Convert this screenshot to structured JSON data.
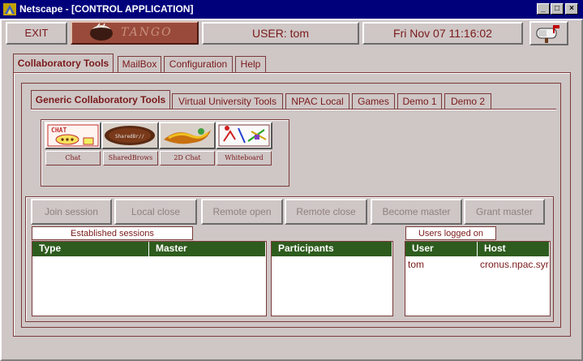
{
  "window": {
    "title": "Netscape - [CONTROL APPLICATION]",
    "minimize_glyph": "_",
    "maximize_glyph": "□",
    "close_glyph": "×"
  },
  "topbar": {
    "exit_label": "EXIT",
    "logo_text": "TANGO",
    "user_label": "USER: tom",
    "datetime": "Fri Nov 07 11:16:02",
    "mail_icon": "mailbox-icon"
  },
  "main_tabs": [
    {
      "label": "Collaboratory Tools",
      "active": true
    },
    {
      "label": "MailBox",
      "active": false
    },
    {
      "label": "Configuration",
      "active": false
    },
    {
      "label": "Help",
      "active": false
    }
  ],
  "sub_tabs": [
    {
      "label": "Generic Collaboratory Tools",
      "active": true
    },
    {
      "label": "Virtual University Tools",
      "active": false
    },
    {
      "label": "NPAC Local",
      "active": false
    },
    {
      "label": "Games",
      "active": false
    },
    {
      "label": "Demo 1",
      "active": false
    },
    {
      "label": "Demo 2",
      "active": false
    }
  ],
  "tools": [
    {
      "label": "Chat",
      "icon": "chat-icon",
      "icon_text": "CHAT"
    },
    {
      "label": "SharedBrows",
      "icon": "shared-browser-icon",
      "icon_text": "SharedBr//"
    },
    {
      "label": "2D Chat",
      "icon": "2d-chat-icon",
      "icon_text": ""
    },
    {
      "label": "Whiteboard",
      "icon": "whiteboard-icon",
      "icon_text": ""
    }
  ],
  "session_buttons": [
    {
      "label": "Join session"
    },
    {
      "label": "Local close"
    },
    {
      "label": "Remote open"
    },
    {
      "label": "Remote close"
    },
    {
      "label": "Become master"
    },
    {
      "label": "Grant master"
    }
  ],
  "sessions": {
    "title": "Established sessions",
    "columns": [
      "Type",
      "Master"
    ],
    "rows": []
  },
  "participants": {
    "columns": [
      "Participants"
    ],
    "rows": []
  },
  "users": {
    "title": "Users logged on",
    "columns": [
      "User",
      "Host"
    ],
    "rows": [
      {
        "user": "tom",
        "host": "cronus.npac.syr"
      }
    ]
  },
  "colors": {
    "title_bar": "#00007b",
    "accent_text": "#7a1a1a",
    "header_green": "#2e5c1e",
    "background": "#cfc6c6"
  }
}
